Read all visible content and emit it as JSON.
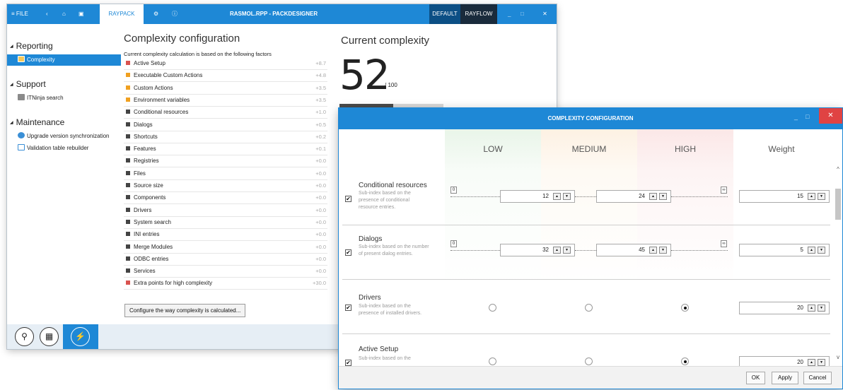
{
  "main_window": {
    "file_label": "≡  FILE",
    "back_icon": "‹",
    "home_icon": "⌂",
    "save_icon": "▣",
    "raypack_tab": "RAYPACK",
    "gear_icon": "⚙",
    "info_icon": "ⓘ",
    "title": "RASMOL.RPP - PACKDESIGNER",
    "mode_default": "DEFAULT",
    "mode_rayflow": "RAYFLOW",
    "min_icon": "_",
    "max_icon": "□",
    "close_icon": "✕"
  },
  "sidebar": {
    "triangle": "◢",
    "reporting_label": "Reporting",
    "complexity_label": "Complexity",
    "support_label": "Support",
    "itninja_label": "ITNinja search",
    "maintenance_label": "Maintenance",
    "upgrade_label": "Upgrade version synchronization",
    "validation_label": "Validation table rebuilder",
    "footer_icon_1": "⚲",
    "footer_icon_2": "▦",
    "footer_icon_3": "⚡"
  },
  "complexity": {
    "title": "Complexity configuration",
    "subtitle": "Current complexity calculation is based on the following factors",
    "factors": [
      {
        "label": "Active Setup",
        "value": "+8.7",
        "color": "#d9534f"
      },
      {
        "label": "Executable Custom Actions",
        "value": "+4.8",
        "color": "#f0a020"
      },
      {
        "label": "Custom Actions",
        "value": "+3.5",
        "color": "#f0a020"
      },
      {
        "label": "Environment variables",
        "value": "+3.5",
        "color": "#f0a020"
      },
      {
        "label": "Conditional resources",
        "value": "+1.0",
        "color": "#444444"
      },
      {
        "label": "Dialogs",
        "value": "+0.5",
        "color": "#444444"
      },
      {
        "label": "Shortcuts",
        "value": "+0.2",
        "color": "#444444"
      },
      {
        "label": "Features",
        "value": "+0.1",
        "color": "#444444"
      },
      {
        "label": "Registries",
        "value": "+0.0",
        "color": "#444444"
      },
      {
        "label": "Files",
        "value": "+0.0",
        "color": "#444444"
      },
      {
        "label": "Source size",
        "value": "+0.0",
        "color": "#444444"
      },
      {
        "label": "Components",
        "value": "+0.0",
        "color": "#444444"
      },
      {
        "label": "Drivers",
        "value": "+0.0",
        "color": "#444444"
      },
      {
        "label": "System search",
        "value": "+0.0",
        "color": "#444444"
      },
      {
        "label": "INI entries",
        "value": "+0.0",
        "color": "#444444"
      },
      {
        "label": "Merge Modules",
        "value": "+0.0",
        "color": "#444444"
      },
      {
        "label": "ODBC entries",
        "value": "+0.0",
        "color": "#444444"
      },
      {
        "label": "Services",
        "value": "+0.0",
        "color": "#444444"
      },
      {
        "label": "Extra points for high complexity",
        "value": "+30.0",
        "color": "#d9534f"
      }
    ],
    "configure_button": "Configure the way complexity is calculated..."
  },
  "current": {
    "title": "Current complexity",
    "value": "52",
    "max": "/ 100",
    "progress": 0.52
  },
  "dialog": {
    "title": "COMPLEXITY CONFIGURATION",
    "min_icon": "_",
    "max_icon": "□",
    "close_icon": "✕",
    "col_low": "LOW",
    "col_medium": "MEDIUM",
    "col_high": "HIGH",
    "col_weight": "Weight",
    "check_mark": "✔",
    "up_arrow": "▲",
    "down_arrow": "▼",
    "scroll_up": "^",
    "scroll_down": "v",
    "zero_tag": "0",
    "inf_tag": "∞",
    "conditional": {
      "name": "Conditional resources",
      "desc": "Sub-index based on the presence of conditional resource entries.",
      "low": "12",
      "high": "24",
      "weight": "15"
    },
    "dialogs": {
      "name": "Dialogs",
      "desc": "Sub-index based on the number of present dialog entries.",
      "low": "32",
      "high": "45",
      "weight": "5"
    },
    "drivers": {
      "name": "Drivers",
      "desc": "Sub-index based on the presence of installed drivers.",
      "weight": "20"
    },
    "active_setup": {
      "name": "Active Setup",
      "desc": "Sub-index based on the",
      "weight": "20"
    },
    "ok": "OK",
    "apply": "Apply",
    "cancel": "Cancel"
  }
}
